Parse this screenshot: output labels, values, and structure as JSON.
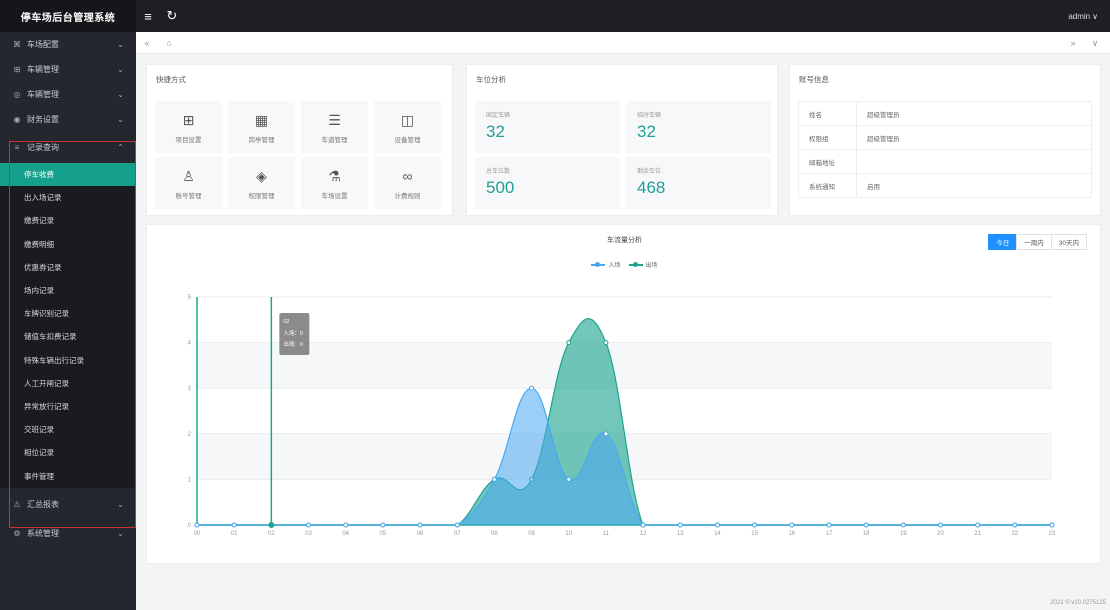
{
  "app": {
    "title": "停车场后台管理系统",
    "user": "admin"
  },
  "header": {
    "menu_icon": "≡",
    "refresh_icon": "↻"
  },
  "sidebar": {
    "items": [
      {
        "icon": "⌘",
        "label": "车场配置"
      },
      {
        "icon": "⊞",
        "label": "车辆管理"
      },
      {
        "icon": "◎",
        "label": "车辆管理"
      },
      {
        "icon": "◉",
        "label": "财务设置"
      },
      {
        "icon": "≡",
        "label": "记录查询"
      }
    ],
    "sub_items": [
      {
        "label": "停车收费"
      },
      {
        "label": "出入场记录"
      },
      {
        "label": "缴费记录"
      },
      {
        "label": "缴费明细"
      },
      {
        "label": "优惠券记录"
      },
      {
        "label": "场内记录"
      },
      {
        "label": "车牌识别记录"
      },
      {
        "label": "储值车扣费记录"
      },
      {
        "label": "特殊车辆出行记录"
      },
      {
        "label": "人工开闸记录"
      },
      {
        "label": "异常放行记录"
      },
      {
        "label": "交班记录"
      },
      {
        "label": "相位记录"
      },
      {
        "label": "事件管理"
      }
    ],
    "bottom_items": [
      {
        "icon": "⚠",
        "label": "汇总报表"
      },
      {
        "icon": "⚙",
        "label": "系统管理"
      }
    ]
  },
  "tabstrip": {
    "back": "«",
    "home": "⌂",
    "forward": "»",
    "more": "∨"
  },
  "quick_access": {
    "title": "快捷方式",
    "tiles": [
      {
        "icon": "⊞",
        "label": "项目设置"
      },
      {
        "icon": "▦",
        "label": "岗亭管理"
      },
      {
        "icon": "☰",
        "label": "车道管理"
      },
      {
        "icon": "◫",
        "label": "设备管理"
      },
      {
        "icon": "♙",
        "label": "账号管理"
      },
      {
        "icon": "◈",
        "label": "权限管理"
      },
      {
        "icon": "⚗",
        "label": "车场设置"
      },
      {
        "icon": "∞",
        "label": "计费规则"
      }
    ]
  },
  "stats": {
    "title": "车位分析",
    "tiles": [
      {
        "label": "固定车辆",
        "value": "32"
      },
      {
        "label": "临时车辆",
        "value": "32"
      },
      {
        "label": "总车位数",
        "value": "500"
      },
      {
        "label": "剩余车位",
        "value": "468"
      }
    ]
  },
  "account": {
    "title": "账号信息",
    "rows": [
      {
        "key": "姓名",
        "value": "超级管理员"
      },
      {
        "key": "权限组",
        "value": "超级管理员"
      },
      {
        "key": "邮箱地址",
        "value": ""
      },
      {
        "key": "系统通知",
        "value": "启用"
      }
    ]
  },
  "range_buttons": [
    "今日",
    "一周内",
    "30天内"
  ],
  "tooltip": {
    "title": "02",
    "in_label": "入场：0",
    "out_label": "出场：0"
  },
  "footer": "2021 © v10.0275125",
  "colors": {
    "accent": "#14a08a",
    "in": "#4aa8f0",
    "out": "#1ca58f",
    "active_button": "#1e90ff"
  },
  "chart_data": {
    "type": "area",
    "title": "车流量分析",
    "x": [
      "00",
      "01",
      "02",
      "03",
      "04",
      "05",
      "06",
      "07",
      "08",
      "09",
      "10",
      "11",
      "12",
      "13",
      "14",
      "15",
      "16",
      "17",
      "18",
      "19",
      "20",
      "21",
      "22",
      "23"
    ],
    "ylim": [
      0,
      5
    ],
    "yticks": [
      0,
      1,
      2,
      3,
      4,
      5
    ],
    "series": [
      {
        "name": "入场",
        "color": "#4aa8f0",
        "values": [
          0,
          0,
          0,
          0,
          0,
          0,
          0,
          0,
          1,
          3,
          1,
          2,
          0,
          0,
          0,
          0,
          0,
          0,
          0,
          0,
          0,
          0,
          0,
          0
        ]
      },
      {
        "name": "出场",
        "color": "#1ca58f",
        "values": [
          0,
          0,
          0,
          0,
          0,
          0,
          0,
          0,
          1,
          1,
          4,
          4,
          0,
          0,
          0,
          0,
          0,
          0,
          0,
          0,
          0,
          0,
          0,
          0
        ]
      }
    ],
    "legend": "top-center",
    "grid": true,
    "highlight_category": "02"
  }
}
